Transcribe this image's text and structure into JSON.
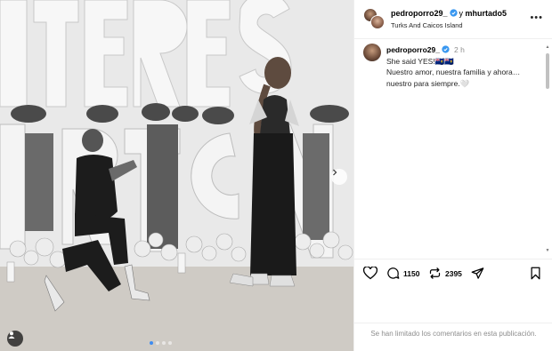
{
  "post": {
    "author": "pedroporro29_",
    "connector": "y",
    "coauthor": "mhurtado5",
    "location": "Turks And Caicos Island"
  },
  "caption": {
    "username": "pedroporro29_",
    "time": "2 h",
    "line1": "She said YES!🇹🇨🇹🇨",
    "line2": "Nuestro amor, nuestra familia y ahora…",
    "line3": "nuestro para siempre.🤍"
  },
  "actions": {
    "comments_count": "1150",
    "reposts_count": "2395"
  },
  "footer": {
    "comments_limited": "Se han limitado los comentarios en esta publicación."
  },
  "photo": {
    "sign_letters": "UTERES RTGN",
    "carousel_pages": 4,
    "carousel_active": 0
  },
  "icons": {
    "more": "more-options-icon",
    "like": "heart-icon",
    "comment": "comment-icon",
    "repost": "repost-icon",
    "share": "share-icon",
    "save": "bookmark-icon",
    "next": "chevron-right-icon",
    "tag": "person-tag-icon",
    "verified": "verified-badge-icon"
  },
  "colors": {
    "verified": "#3897f0",
    "active_dot": "#3f8cf0",
    "muted_text": "#8e8e8e"
  }
}
